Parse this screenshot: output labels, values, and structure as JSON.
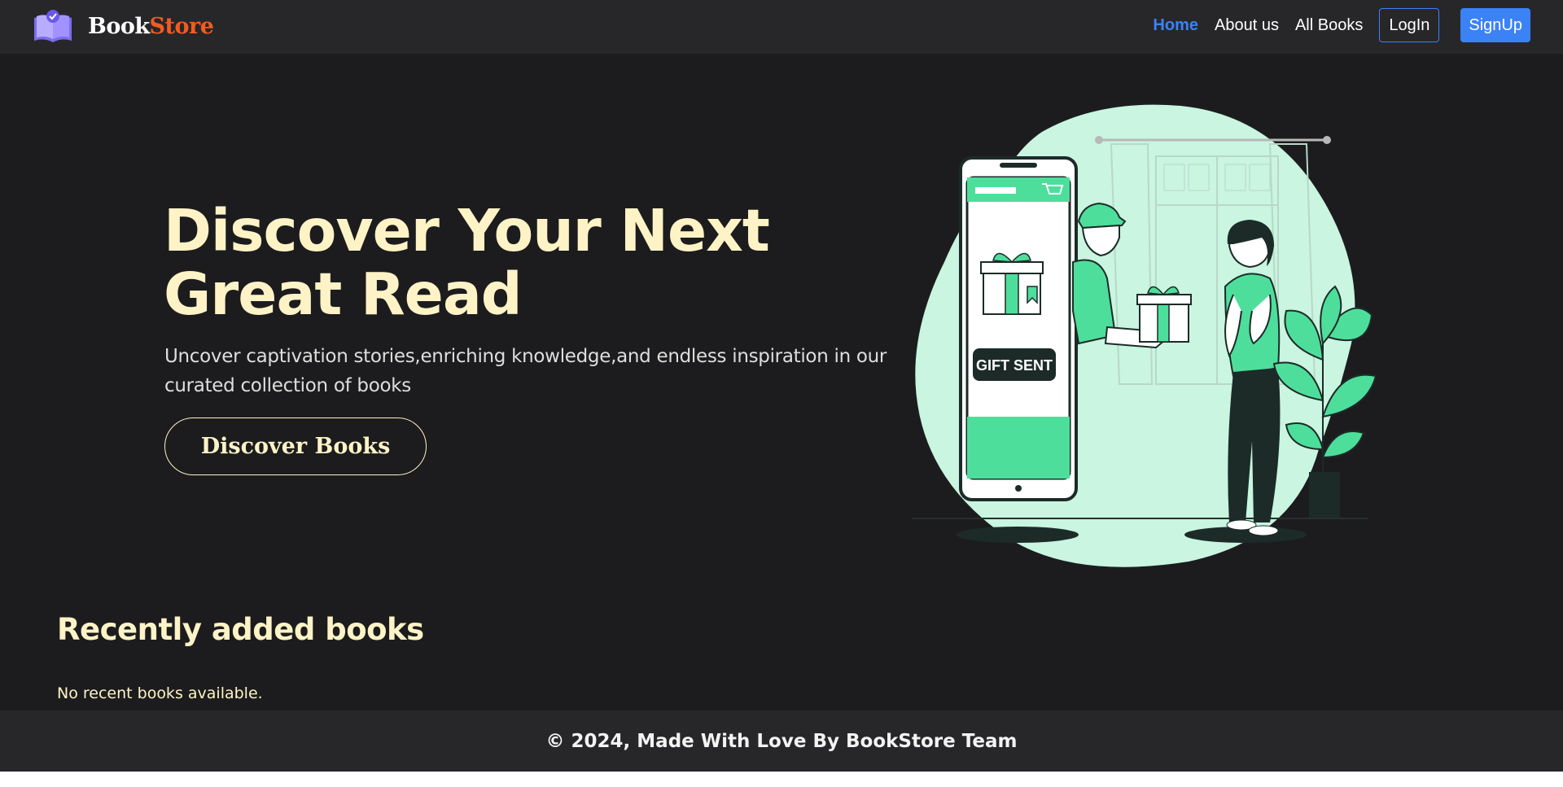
{
  "header": {
    "brand_part1": "Book",
    "brand_part2": "Store",
    "nav": {
      "home": "Home",
      "about": "About us",
      "all_books": "All Books",
      "login": "LogIn",
      "signup": "SignUp"
    }
  },
  "hero": {
    "title": "Discover Your Next Great Read",
    "subtitle": "Uncover captivation stories,enriching knowledge,and endless inspiration in our curated collection of books",
    "cta": "Discover Books",
    "illustration_caption": "GIFT SENT"
  },
  "recent": {
    "title": "Recently added books",
    "empty_message": "No recent books available."
  },
  "footer": {
    "text": "© 2024, Made With Love By BookStore Team"
  },
  "colors": {
    "background": "#1c1c1e",
    "navbar": "#27272a",
    "accent": "#3b82f6",
    "cream": "#fdf3c6",
    "brand_orange": "#f25c1e",
    "mint": "#c9f5e1",
    "green": "#4ede9b"
  },
  "icons": {
    "logo": "open-book-icon",
    "cart": "cart-icon"
  }
}
